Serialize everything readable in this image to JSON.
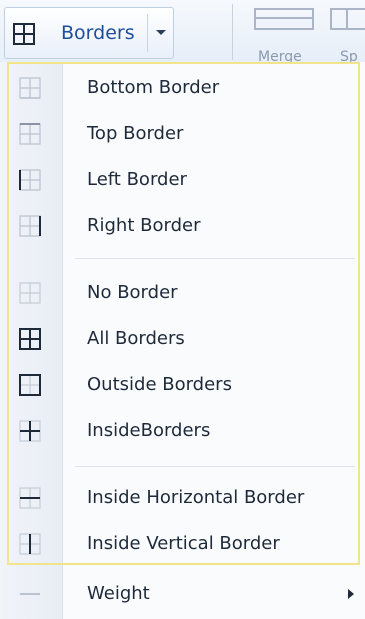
{
  "ribbon": {
    "borders_label": "Borders",
    "merge_label": "Merge",
    "split_label": "Sp"
  },
  "menu": {
    "items": [
      {
        "label": "Bottom Border",
        "icon": "bottom-border-icon"
      },
      {
        "label": "Top Border",
        "icon": "top-border-icon"
      },
      {
        "label": "Left Border",
        "icon": "left-border-icon"
      },
      {
        "label": "Right Border",
        "icon": "right-border-icon"
      },
      {
        "label": "No Border",
        "icon": "no-border-icon"
      },
      {
        "label": "All Borders",
        "icon": "all-borders-icon"
      },
      {
        "label": "Outside Borders",
        "icon": "outside-borders-icon"
      },
      {
        "label": "InsideBorders",
        "icon": "inside-borders-icon"
      },
      {
        "label": "Inside Horizontal Border",
        "icon": "inside-horizontal-border-icon"
      },
      {
        "label": "Inside Vertical Border",
        "icon": "inside-vertical-border-icon"
      },
      {
        "label": "Weight",
        "icon": "weight-icon"
      }
    ]
  },
  "colors": {
    "accent_text": "#1d4e9c",
    "hover_border": "#f2e48a",
    "icon_dark": "#1e2a3a",
    "icon_light": "#b8c2d0"
  }
}
